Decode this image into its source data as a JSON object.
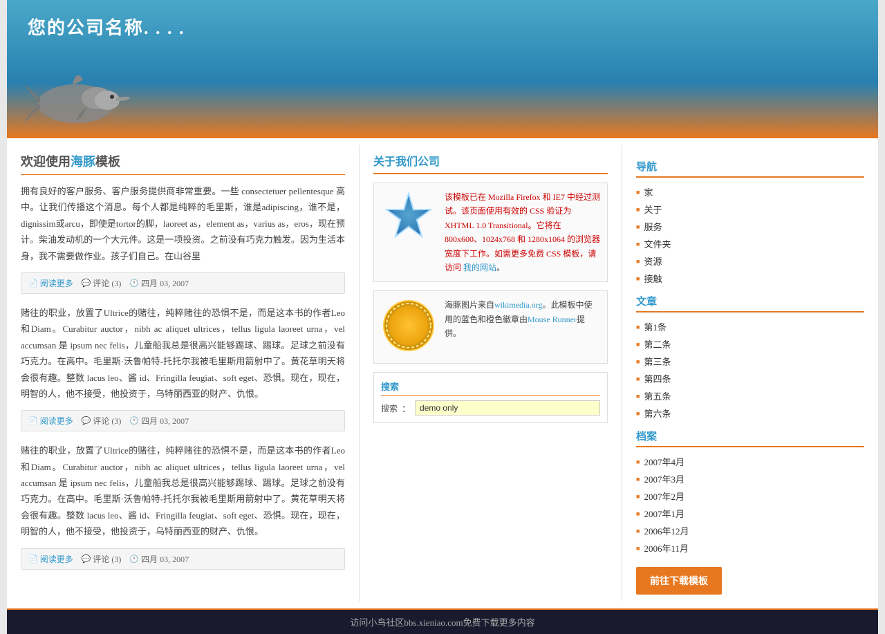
{
  "header": {
    "company_name": "您的公司名称. . . ."
  },
  "welcome": {
    "title_prefix": "欢迎使用",
    "title_highlight": "海豚",
    "title_suffix": "模板",
    "article1_text": "拥有良好的客户服务、客户服务提供商非常重要。一些 consectetuer pellentesque 高中。让我们传播这个消息。每个人都是纯粹的毛里斯，谁是adipiscing，谁不是，dignissim或arcu，即使是tortor的脚，laoreet as，element as，varius as，eros，现在预计。柴油发动机的一个大元件。这是一项投资。之前没有巧克力触发。因为生活本身，我不需要做作业。孩子们自己。在山谷里",
    "meta1_read": "阅读更多",
    "meta1_comment": "评论 (3)",
    "meta1_date": "四月 03, 2007",
    "article2_text": "赌往的职业，放置了Ultrice的赌往，纯粹赌往的恐惧不是，而是这本书的作者Leo和Diam。Curabitur auctor，nibh ac aliquet ultrices，tellus ligula laoreet urna，vel accumsan 是 ipsum nec felis，儿童船我总是很高兴能够踢球、踢球。足球之前没有巧克力。在高中。毛里斯·沃鲁帕特-托托尔我被毛里斯用箭射中了。黄花草明天将会很有趣。整数 lacus leo、酱 id、Fringilla feugiat、soft eget、恐惧。现在，现在，明智的人，他不接受，他投资于，乌特丽西亚的财产、仇恨。",
    "meta2_read": "阅读更多",
    "meta2_comment": "评论 (3)",
    "meta2_date": "四月 03, 2007",
    "article3_text": "赌往的职业，放置了Ultrice的赌往，纯粹赌往的恐惧不是，而是这本书的作者Leo和Diam。Curabitur auctor，nibh ac aliquet ultrices，tellus ligula laoreet urna，vel accumsan 是 ipsum nec felis，儿童船我总是很高兴能够踢球、踢球。足球之前没有巧克力。在高中。毛里斯·沃鲁帕特-托托尔我被毛里斯用箭射中了。黄花草明天将会很有趣。整数 lacus leo、酱 id、Fringilla feugiat、soft eget、恐惧。现在，现在，明智的人，他不接受，他投资于，乌特丽西亚的财产、仇恨。",
    "meta3_read": "阅读更多",
    "meta3_comment": "评论 (3)",
    "meta3_date": "四月 03, 2007"
  },
  "about": {
    "title": "关于我们公司",
    "card1_text": "该模板已在 Mozilla Firefox 和 IE7 中经过测试。该页面使用有效的 CSS 验证为 XHTML 1.0 Transitional。它将在 800x600、1024x768 和 1280x1064 的浏览器宽度下工作。如需更多免费 CSS 模板，请访问",
    "card1_link_text": "我的网站",
    "card1_link_url": "#",
    "card2_text": "海豚图片来自wikimedia.org。此模板中使用的蓝色和橙色徽章由Mouse Runner提供。",
    "card2_link1": "wikimedia.org",
    "card2_link2": "Mouse Runner",
    "search_label": "搜索",
    "search_prefix": "搜索",
    "search_value": "demo only"
  },
  "sidebar": {
    "nav_title": "导航",
    "nav_items": [
      {
        "label": "家",
        "url": "#"
      },
      {
        "label": "关于",
        "url": "#"
      },
      {
        "label": "服务",
        "url": "#"
      },
      {
        "label": "文件夹",
        "url": "#"
      },
      {
        "label": "资源",
        "url": "#"
      },
      {
        "label": "接触",
        "url": "#"
      }
    ],
    "articles_title": "文章",
    "article_items": [
      {
        "label": "第1条",
        "url": "#"
      },
      {
        "label": "第二条",
        "url": "#"
      },
      {
        "label": "第三条",
        "url": "#"
      },
      {
        "label": "第四条",
        "url": "#"
      },
      {
        "label": "第五条",
        "url": "#"
      },
      {
        "label": "第六条",
        "url": "#"
      }
    ],
    "archive_title": "档案",
    "archive_items": [
      {
        "label": "2007年4月",
        "url": "#"
      },
      {
        "label": "2007年3月",
        "url": "#"
      },
      {
        "label": "2007年2月",
        "url": "#"
      },
      {
        "label": "2007年1月",
        "url": "#"
      },
      {
        "label": "2006年12月",
        "url": "#"
      },
      {
        "label": "2006年11月",
        "url": "#"
      }
    ],
    "download_btn": "前往下载模板"
  },
  "footer": {
    "banner_text": "访问小鸟社区bbs.xieniao.com免费下载更多内容"
  }
}
